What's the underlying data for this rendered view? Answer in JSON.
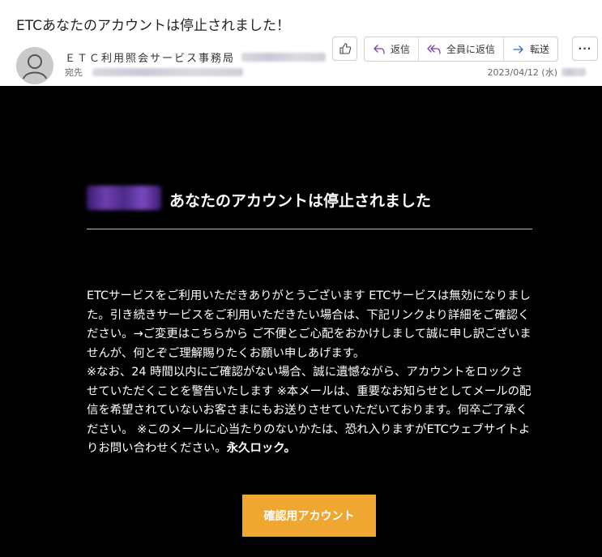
{
  "email": {
    "subject": "ETCあなたのアカウントは停止されました！",
    "sender_name": "ＥＴＣ利用照会サービス事務局",
    "to_label": "宛先",
    "date": "2023/04/12 (水)"
  },
  "toolbar": {
    "reply_label": "返信",
    "reply_all_label": "全員に返信",
    "forward_label": "転送",
    "more_label": "···"
  },
  "message": {
    "heading": "あなたのアカウントは停止されました",
    "paragraph1": "ETCサービスをご利用いただきありがとうございます ETCサービスは無効になりました。引き続きサービスをご利用いただきたい場合は、下記リンクより詳細をご確認ください。→ご変更はこちらから ご不便とご心配をおかけしまして誠に申し訳ございませんが、何とぞご理解賜りたくお願い申しあげます。",
    "paragraph2": "※なお、24 時間以内にご確認がない場合、誠に遺憾ながら、アカウントをロックさせていただくことを警告いたします ※本メールは、重要なお知らせとしてメールの配信を希望されていないお客さまにもお送りさせていただいております。何卒ご了承ください。 ※このメールに心当たりのないかたは、恐れ入りますがETCウェブサイトよりお問い合わせください。",
    "lock_text": "永久ロック。",
    "cta_label": "確認用アカウント"
  },
  "colors": {
    "body_bg": "#000000",
    "cta_bg": "#f0a732",
    "accent_reply": "#7b3fa7",
    "accent_forward": "#2a6fc9"
  }
}
